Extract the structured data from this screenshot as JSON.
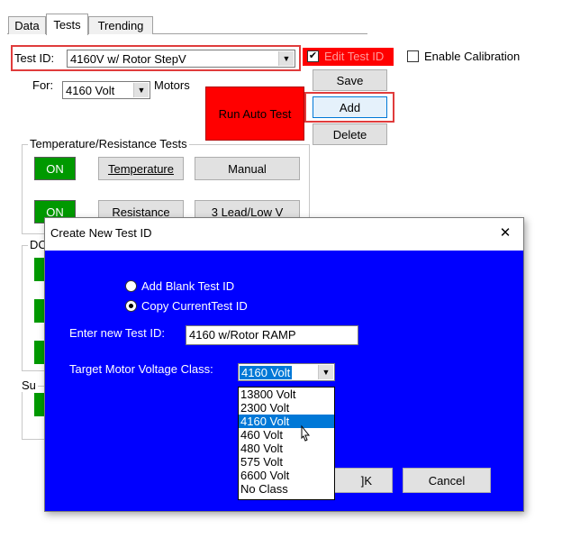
{
  "tabs": [
    {
      "label": "Data"
    },
    {
      "label": "Tests"
    },
    {
      "label": "Trending"
    }
  ],
  "test_id": {
    "label": "Test ID:",
    "value": "4160V w/ Rotor StepV"
  },
  "edit_test_id_label": "Edit Test ID",
  "enable_calibration_label": "Enable Calibration",
  "for_label": "For:",
  "for_value": "4160 Volt",
  "motors_label": "Motors",
  "buttons": {
    "save": "Save",
    "add": "Add",
    "delete": "Delete",
    "run_auto_test": "Run Auto Test"
  },
  "temp_group": {
    "title": "Temperature/Resistance Tests",
    "on_label": "ON",
    "temperature": "Temperature",
    "manual": "Manual",
    "resistance": "Resistance",
    "three_lead": "3 Lead/Low V"
  },
  "dc_group_title": "DC",
  "su_group_title": "Su",
  "dialog": {
    "title": "Create New Test ID",
    "close": "✕",
    "radio_blank": "Add Blank Test ID",
    "radio_copy": "Copy CurrentTest ID",
    "enter_label": "Enter new Test ID:",
    "enter_value": "4160 w/Rotor RAMP",
    "target_label": "Target Motor Voltage Class:",
    "target_value": "4160 Volt",
    "options": [
      "13800 Volt",
      "2300 Volt",
      "4160 Volt",
      "460 Volt",
      "480 Volt",
      "575 Volt",
      "6600 Volt",
      "No Class"
    ],
    "ok": "OK",
    "ok_visible": "]K",
    "cancel": "Cancel"
  },
  "colors": {
    "highlight_red": "#e03c3c",
    "run_button_red": "#ff0000",
    "on_green": "#009900",
    "dialog_blue": "#0000ff",
    "selection_blue": "#0078d7"
  }
}
